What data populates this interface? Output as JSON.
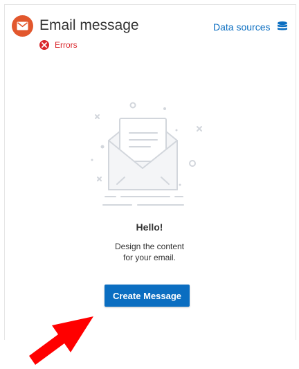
{
  "header": {
    "title": "Email message",
    "status_label": "Errors",
    "data_sources_label": "Data sources",
    "icons": {
      "badge": "email-icon",
      "status": "error-icon",
      "data_sources": "database-icon"
    }
  },
  "empty_state": {
    "heading": "Hello!",
    "description_line1": "Design the content",
    "description_line2": "for your email.",
    "illustration": "envelope-letter-illustration"
  },
  "actions": {
    "create_message_label": "Create Message"
  },
  "annotation": {
    "type": "pointer-arrow",
    "color": "#ff0000"
  },
  "colors": {
    "accent": "#0b6ec1",
    "email_badge": "#e2572d",
    "error": "#d9262b"
  }
}
